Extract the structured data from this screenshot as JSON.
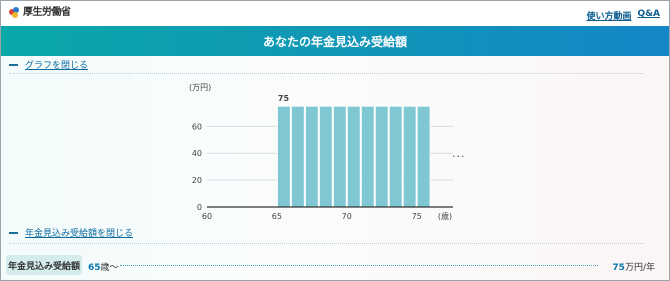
{
  "top_bar": {
    "logo_text": "厚生労働省",
    "links": [
      "使い方動画",
      "Q&A"
    ]
  },
  "header": {
    "title": "あなたの年金見込み受給額"
  },
  "graph_toggle": {
    "label": "グラフを閉じる"
  },
  "chart_data": {
    "type": "bar",
    "unit_label": "(万円)",
    "x_unit_label": "(歳)",
    "x_ticks": [
      "60",
      "65",
      "70",
      "75"
    ],
    "y_ticks": [
      "0",
      "20",
      "40",
      "60"
    ],
    "ylim": [
      0,
      90
    ],
    "xlim": [
      60,
      77.6
    ],
    "categories": [
      65,
      66,
      67,
      68,
      69,
      70,
      71,
      72,
      73,
      74,
      75
    ],
    "values": [
      75,
      75,
      75,
      75,
      75,
      75,
      75,
      75,
      75,
      75,
      75
    ],
    "data_label": "75",
    "bar_color": "#7fc8d3",
    "more_indicator": "···"
  },
  "amount_toggle": {
    "label": "年金見込み受給額を閉じる"
  },
  "summary": {
    "badge": "年金見込み受給額",
    "start_age": "65",
    "start_suffix": "歳〜",
    "amount": "75",
    "amount_unit": "万円/年"
  },
  "colors": {
    "accent": "#0d6aa0",
    "header_start": "#0aa8a8",
    "header_end": "#1586c6"
  }
}
